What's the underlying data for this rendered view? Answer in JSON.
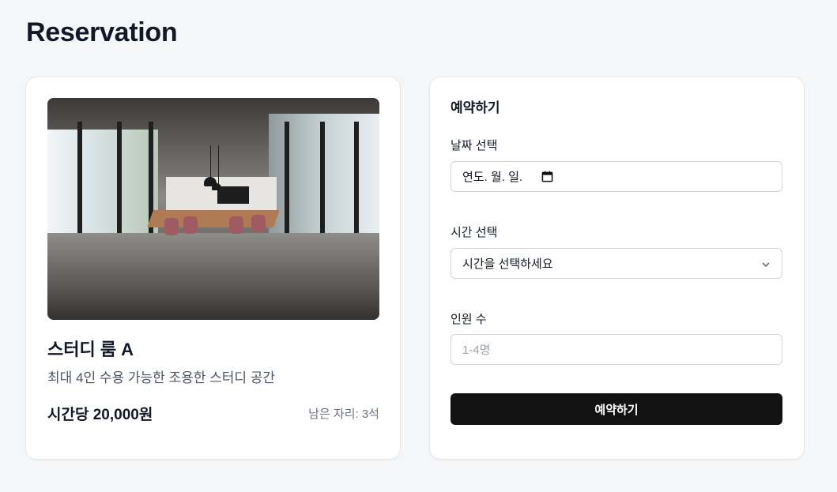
{
  "page": {
    "title": "Reservation"
  },
  "room": {
    "image_alt": "meeting-room-photo",
    "name": "스터디 룸 A",
    "description": "최대 4인 수용 가능한 조용한 스터디 공간",
    "price": "시간당 20,000원",
    "seats": "남은 자리: 3석"
  },
  "form": {
    "title": "예약하기",
    "date": {
      "label": "날짜 선택",
      "value": "연도. 월. 일.",
      "icon": "calendar-icon"
    },
    "time": {
      "label": "시간 선택",
      "value": "시간을 선택하세요",
      "icon": "chevron-down-icon"
    },
    "people": {
      "label": "인원 수",
      "placeholder": "1-4명"
    },
    "submit_label": "예약하기"
  },
  "colors": {
    "background": "#f5f6f8",
    "card": "#ffffff",
    "button": "#121212",
    "border": "#d1d5db"
  }
}
